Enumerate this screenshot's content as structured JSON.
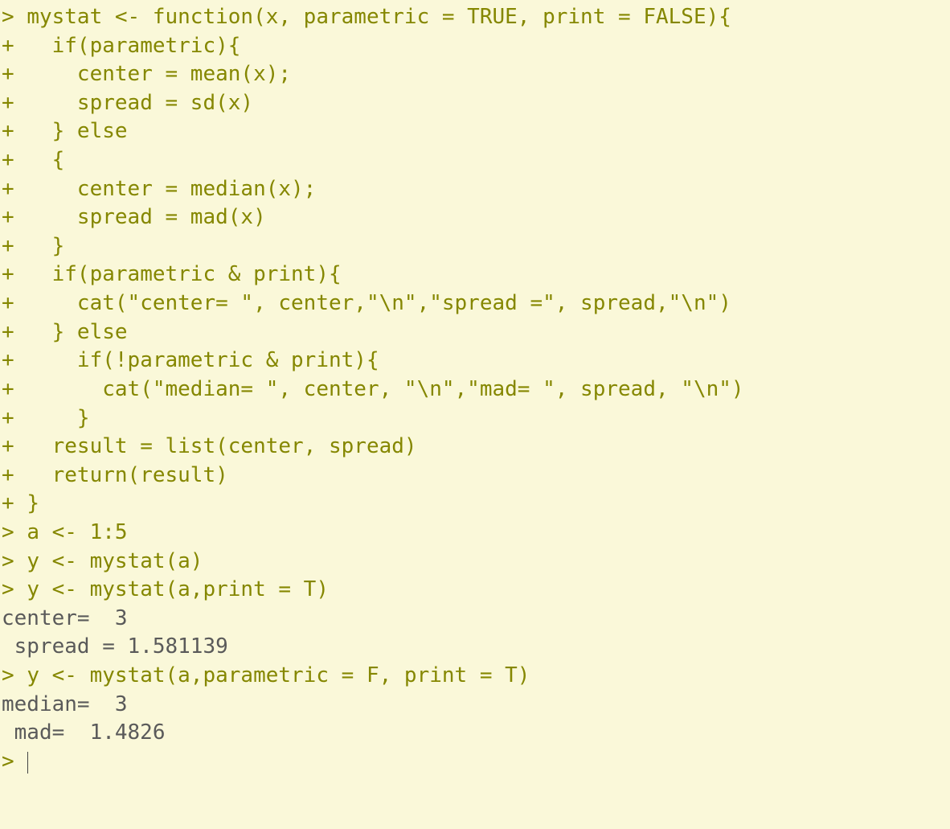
{
  "console": {
    "lines": [
      {
        "type": "input",
        "prompt": "> ",
        "text": "mystat <- function(x, parametric = TRUE, print = FALSE){"
      },
      {
        "type": "input",
        "prompt": "+ ",
        "text": "  if(parametric){"
      },
      {
        "type": "input",
        "prompt": "+ ",
        "text": "    center = mean(x);"
      },
      {
        "type": "input",
        "prompt": "+ ",
        "text": "    spread = sd(x)"
      },
      {
        "type": "input",
        "prompt": "+ ",
        "text": "  } else"
      },
      {
        "type": "input",
        "prompt": "+ ",
        "text": "  {"
      },
      {
        "type": "input",
        "prompt": "+ ",
        "text": "    center = median(x);"
      },
      {
        "type": "input",
        "prompt": "+ ",
        "text": "    spread = mad(x)"
      },
      {
        "type": "input",
        "prompt": "+ ",
        "text": "  }"
      },
      {
        "type": "input",
        "prompt": "+ ",
        "text": "  if(parametric & print){"
      },
      {
        "type": "input",
        "prompt": "+ ",
        "text": "    cat(\"center= \", center,\"\\n\",\"spread =\", spread,\"\\n\")"
      },
      {
        "type": "input",
        "prompt": "+ ",
        "text": "  } else"
      },
      {
        "type": "input",
        "prompt": "+ ",
        "text": "    if(!parametric & print){"
      },
      {
        "type": "input",
        "prompt": "+ ",
        "text": "      cat(\"median= \", center, \"\\n\",\"mad= \", spread, \"\\n\")"
      },
      {
        "type": "input",
        "prompt": "+ ",
        "text": "    }"
      },
      {
        "type": "input",
        "prompt": "+ ",
        "text": "  result = list(center, spread)"
      },
      {
        "type": "input",
        "prompt": "+ ",
        "text": "  return(result)"
      },
      {
        "type": "input",
        "prompt": "+ ",
        "text": "}"
      },
      {
        "type": "input",
        "prompt": "> ",
        "text": "a <- 1:5"
      },
      {
        "type": "input",
        "prompt": "> ",
        "text": "y <- mystat(a)"
      },
      {
        "type": "input",
        "prompt": "> ",
        "text": "y <- mystat(a,print = T)"
      },
      {
        "type": "output",
        "prompt": "",
        "text": "center=  3 "
      },
      {
        "type": "output",
        "prompt": "",
        "text": " spread = 1.581139 "
      },
      {
        "type": "input",
        "prompt": "> ",
        "text": "y <- mystat(a,parametric = F, print = T)"
      },
      {
        "type": "output",
        "prompt": "",
        "text": "median=  3 "
      },
      {
        "type": "output",
        "prompt": "",
        "text": " mad=  1.4826 "
      },
      {
        "type": "input",
        "prompt": "> ",
        "text": "",
        "cursor": true
      }
    ]
  }
}
